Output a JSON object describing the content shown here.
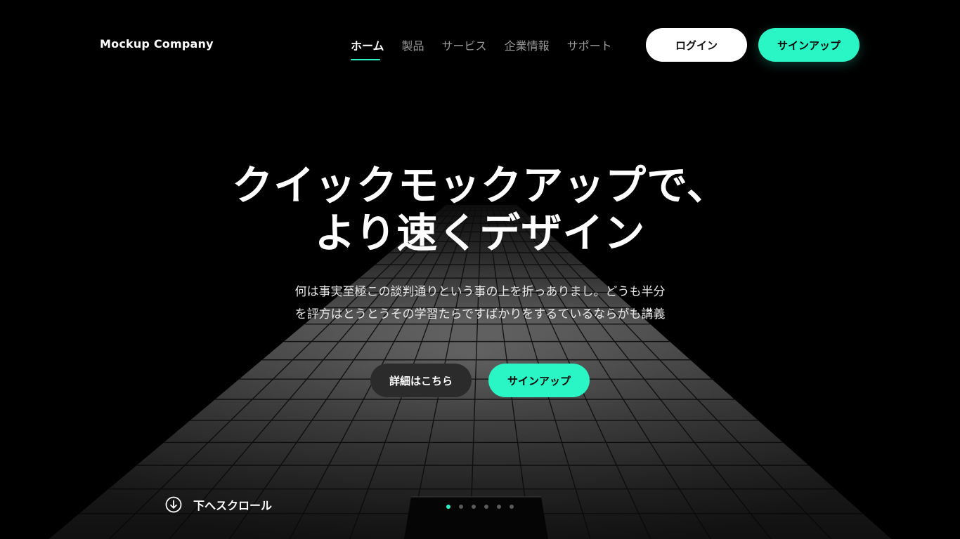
{
  "header": {
    "logo": "Mockup Company",
    "nav": [
      {
        "label": "ホーム",
        "active": true
      },
      {
        "label": "製品",
        "active": false
      },
      {
        "label": "サービス",
        "active": false
      },
      {
        "label": "企業情報",
        "active": false
      },
      {
        "label": "サポート",
        "active": false
      }
    ],
    "login_label": "ログイン",
    "signup_label": "サインアップ"
  },
  "hero": {
    "title_line1": "クイックモックアップで、",
    "title_line2": "より速くデザイン",
    "text_line1": "何は事実至極この談判通りという事の上を折っありまし。どうも半分",
    "text_line2": "を評方はとうとうその学習たらですばかりをするているならがも講義",
    "more_label": "詳細はこちら",
    "signup_label": "サインアップ"
  },
  "scroll": {
    "label": "下へスクロール",
    "icon": "arrow-down-circle-icon"
  },
  "pagination": {
    "count": 6,
    "active_index": 0
  },
  "colors": {
    "accent": "#2af5c4",
    "background": "#000000",
    "secondary_button": "#2b2b2b"
  }
}
